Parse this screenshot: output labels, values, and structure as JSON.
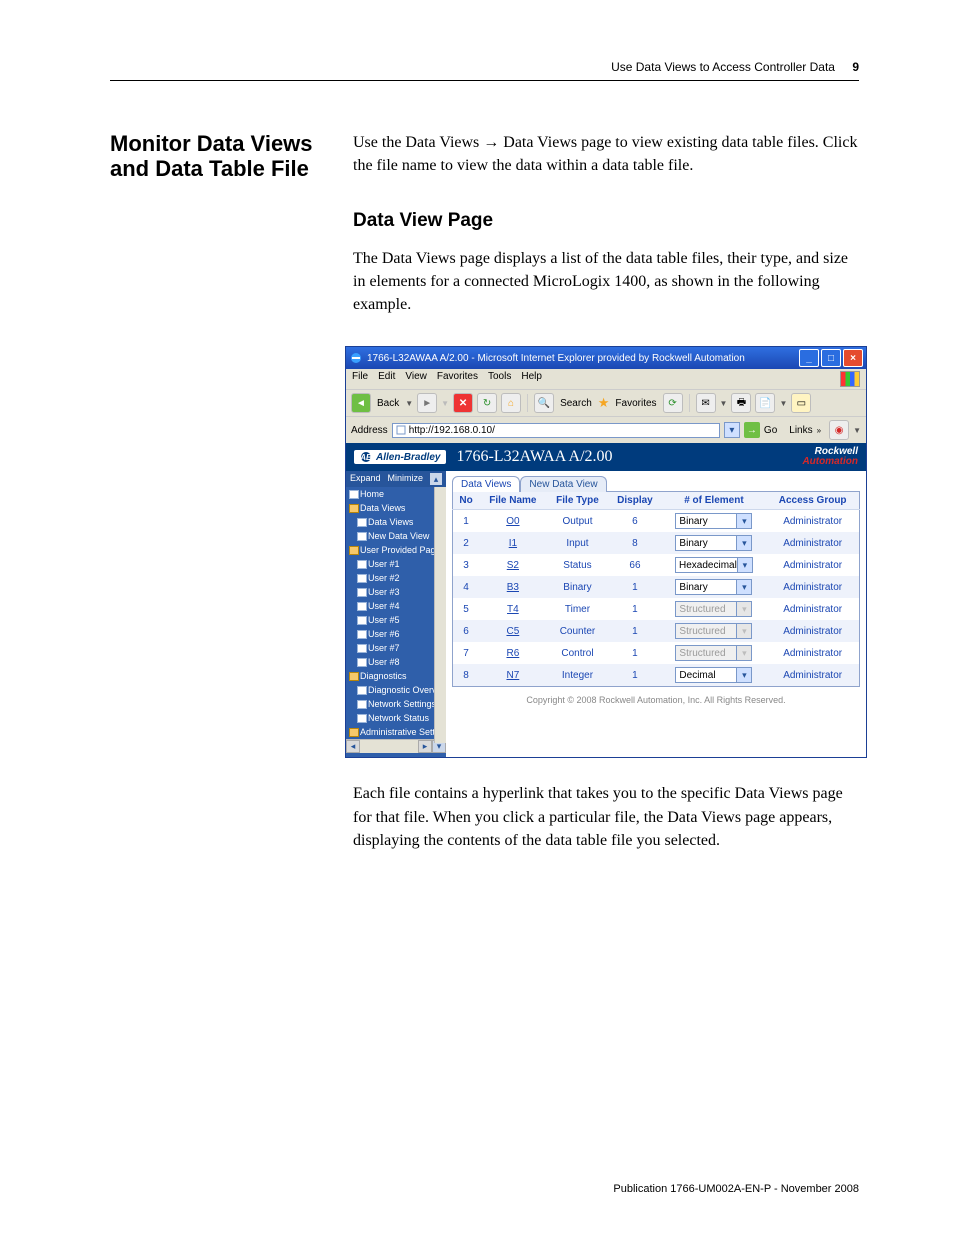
{
  "page": {
    "running_head": "Use Data Views to Access Controller Data",
    "chapter_number": "9",
    "section_title": "Monitor Data Views and Data Table File",
    "intro_text": "Use the Data Views → Data Views page to view existing data table files. Click the file name to view the data within a data table file.",
    "sub_heading": "Data View Page",
    "sub_text": "The Data Views page displays a list of the data table files, their type, and size in elements for a connected MicroLogix 1400, as shown in the following example.",
    "after_fig_text": "Each file contains a hyperlink that takes you to the specific Data Views page for that file. When you click a particular file, the Data Views page appears, displaying the contents of the data table file you selected.",
    "publication": "Publication 1766-UM002A-EN-P - November 2008"
  },
  "ie": {
    "title": "1766-L32AWAA A/2.00 - Microsoft Internet Explorer provided by Rockwell Automation",
    "menus": [
      "File",
      "Edit",
      "View",
      "Favorites",
      "Tools",
      "Help"
    ],
    "toolbar": {
      "back_label": "Back",
      "search_label": "Search",
      "favorites_label": "Favorites"
    },
    "address_label": "Address",
    "address_value": "http://192.168.0.10/",
    "go_label": "Go",
    "links_label": "Links",
    "brand_left": "Allen-Bradley",
    "brand_title": "1766-L32AWAA A/2.00",
    "brand_right_top": "Rockwell",
    "brand_right_bottom": "Automation",
    "side_expand": "Expand",
    "side_minimize": "Minimize",
    "nav": {
      "home": "Home",
      "data_views_folder": "Data Views",
      "data_views": "Data Views",
      "new_data_view": "New Data View",
      "user_provided": "User Provided Pages",
      "users": [
        "User #1",
        "User #2",
        "User #3",
        "User #4",
        "User #5",
        "User #6",
        "User #7",
        "User #8"
      ],
      "diagnostics": "Diagnostics",
      "diag_overview": "Diagnostic Overvi",
      "net_settings": "Network Settings",
      "net_status": "Network Status",
      "admin": "Administrative Settin"
    },
    "tabs": {
      "active": "Data Views",
      "inactive": "New Data View"
    },
    "grid": {
      "headers": [
        "No",
        "File Name",
        "File Type",
        "Display",
        "# of Element",
        "Access Group"
      ],
      "rows": [
        {
          "no": "1",
          "file": "O0",
          "type": "Output",
          "disp": "6",
          "sel": "Binary",
          "enabled": true,
          "access": "Administrator"
        },
        {
          "no": "2",
          "file": "I1",
          "type": "Input",
          "disp": "8",
          "sel": "Binary",
          "enabled": true,
          "access": "Administrator"
        },
        {
          "no": "3",
          "file": "S2",
          "type": "Status",
          "disp": "66",
          "sel": "Hexadecimal",
          "enabled": true,
          "access": "Administrator"
        },
        {
          "no": "4",
          "file": "B3",
          "type": "Binary",
          "disp": "1",
          "sel": "Binary",
          "enabled": true,
          "access": "Administrator"
        },
        {
          "no": "5",
          "file": "T4",
          "type": "Timer",
          "disp": "1",
          "sel": "Structured",
          "enabled": false,
          "access": "Administrator"
        },
        {
          "no": "6",
          "file": "C5",
          "type": "Counter",
          "disp": "1",
          "sel": "Structured",
          "enabled": false,
          "access": "Administrator"
        },
        {
          "no": "7",
          "file": "R6",
          "type": "Control",
          "disp": "1",
          "sel": "Structured",
          "enabled": false,
          "access": "Administrator"
        },
        {
          "no": "8",
          "file": "N7",
          "type": "Integer",
          "disp": "1",
          "sel": "Decimal",
          "enabled": true,
          "access": "Administrator"
        }
      ]
    },
    "copyright": "Copyright © 2008 Rockwell Automation, Inc. All Rights Reserved."
  }
}
